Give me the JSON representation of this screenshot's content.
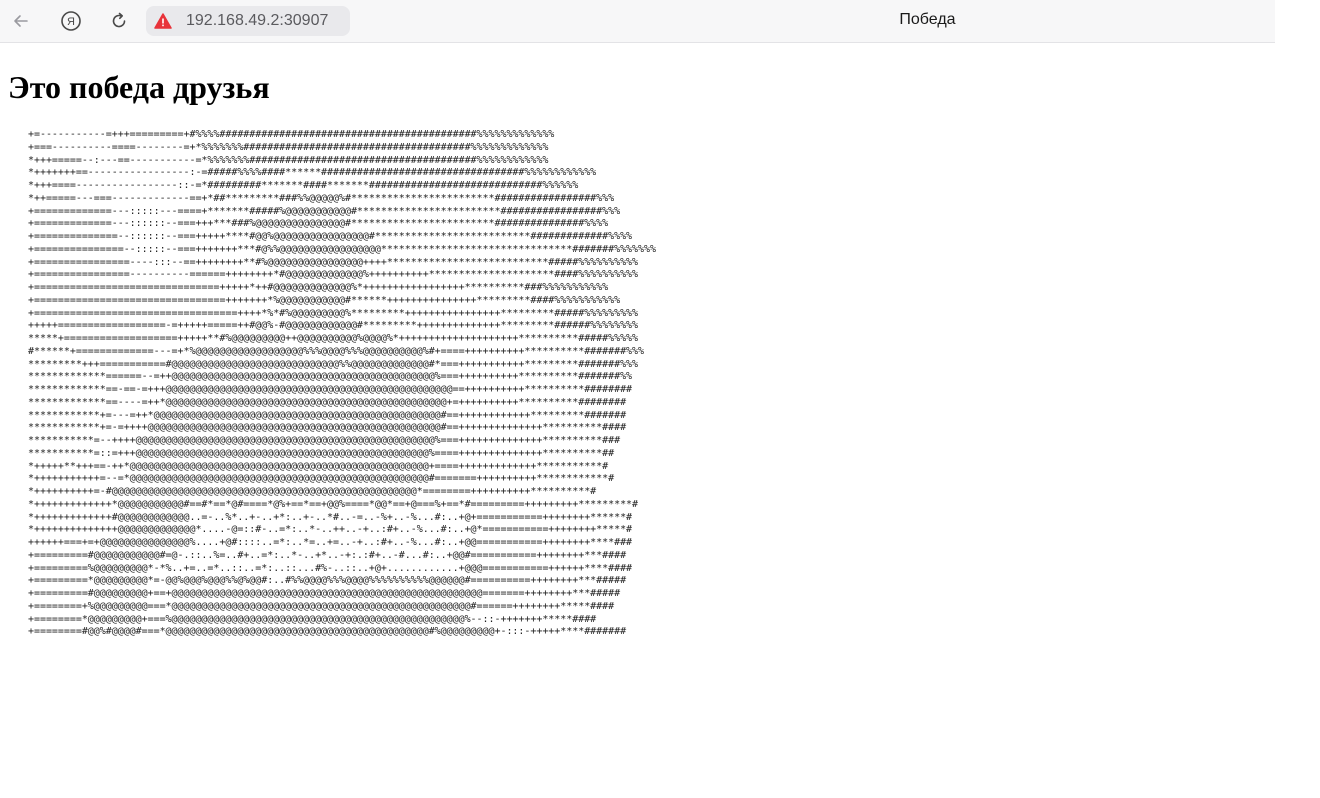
{
  "browser": {
    "url": "192.168.49.2:30907",
    "tab_title": "Победа",
    "icons": {
      "back": "back-arrow-icon",
      "yandex": "yandex-logo-icon",
      "reload": "reload-icon",
      "security": "insecure-warning-icon"
    },
    "colors": {
      "warning": "#e8333a",
      "bar_background": "#f7f7f8",
      "url_pill": "#e9e9ec"
    }
  },
  "page": {
    "title": "Это победа друзья",
    "ascii_art": "+=-----------=+++=========+#%%%%###########################################%%%%%%%%%%%%%\n+===----------====--------=+*%%%%%%%######################################%%%%%%%%%%%%%\n*+++=====--:---==-----------=*%%%%%%%######################################%%%%%%%%%%%%\n*+++++++==-----------------:-=#####%%%%####******##################################%%%%%%%%%%%%\n*+++====-----------------::-=*#########*******####*******#############################%%%%%%\n*++=====---===-------------==+*##*********###%%@@@@@%#************************#################%%%\n+=============---:::::---====+*******#####%@@@@@@@@@@@#************************#################%%%\n+=============---::::::--===+++***###%@@@@@@@@@@@@@@@#************************###############%%%%\n+==============--::::::--===+++++****#@@%@@@@@@@@@@@@@@@@#**************************#############%%%%\n+===============--:::::--===+++++++***#@%%@@@@@@@@@@@@@@@@@********************************#######%%%%%%%\n+================----:::--==++++++++**#%@@@@@@@@@@@@@@@@++++***************************#####%%%%%%%%%%\n+================----------======++++++++*#@@@@@@@@@@@@@%++++++++++*********************####%%%%%%%%%%\n+===============================+++++*++#@@@@@@@@@@@@@%*+++++++++++++++++**********###%%%%%%%%%%%\n+================================+++++++*%@@@@@@@@@@@#******+++++++++++++++*********####%%%%%%%%%%%\n+==================================++++*%*#%@@@@@@@@@%*********++++++++++++++++*********#####%%%%%%%%%\n+++++==================-=+++++=====++#@@%-#@@@@@@@@@@@@#*********++++++++++++++*********######%%%%%%%%\n*****+===================+++++**#%@@@@@@@@@++@@@@@@@@@@%@@@@%*++++++++++++++++++++**********#####%%%%%\n#******+=============---=+*%@@@@@@@@@@@@@@@@@@%%%@@@@%%%@@@@@@@@@@%#+====++++++++++**********#######%%%\n*********+++===========#@@@@@@@@@@@@@@@@@@@@@@@@@@@@%%@@@@@@@@@@@@@#*===+++++++++++*********#######%%%\n*************======--=++@@@@@@@@@@@@@@@@@@@@@@@@@@@@@@@@@@@@@@@@@@@@%===++++++++++**********#######%%\n*************==-==-=+++@@@@@@@@@@@@@@@@@@@@@@@@@@@@@@@@@@@@@@@@@@@@@@@@==++++++++++**********########\n*************==----=++*@@@@@@@@@@@@@@@@@@@@@@@@@@@@@@@@@@@@@@@@@@@@@@@+=++++++++++**********########\n************+=---=++*@@@@@@@@@@@@@@@@@@@@@@@@@@@@@@@@@@@@@@@@@@@@@@@@#==++++++++++++*********#######\n************+=-=++++@@@@@@@@@@@@@@@@@@@@@@@@@@@@@@@@@@@@@@@@@@@@@@@@@#==++++++++++++++**********####\n***********=--++++@@@@@@@@@@@@@@@@@@@@@@@@@@@@@@@@@@@@@@@@@@@@@@@@@@%===++++++++++++++**********###\n***********=::=+++@@@@@@@@@@@@@@@@@@@@@@@@@@@@@@@@@@@@@@@@@@@@@@@@@%====++++++++++++++**********##\n*+++++**+++==-++*@@@@@@@@@@@@@@@@@@@@@@@@@@@@@@@@@@@@@@@@@@@@@@@@@@+====+++++++++++++***********#\n*+++++++++++=--=*@@@@@@@@@@@@@@@@@@@@@@@@@@@@@@@@@@@@@@@@@@@@@@@@@@#=======++++++++++************#\n*++++++++++=-#@@@@@@@@@@@@@@@@@@@@@@@@@@@@@@@@@@@@@@@@@@@@@@@@@@@*========++++++++++**********#\n*+++++++++++++*@@@@@@@@@@@#==#*==*@#====*@%+==*==+@@%====*@@*==+@===%+==*#=========+++++++++*********#\n*+++++++++++++#@@@@@@@@@@@@..=-..%*..+-..+*:..+-..*#..-=..-%+..-%...#:..+@+===========++++++++******#\n*++++++++++++++@@@@@@@@@@@@@*....-@=::#-..=*:..*-..++..-+..:#+..-%...#:..+@*===========++++++++*****#\n++++++===+=+@@@@@@@@@@@@@@@%....+@#::::..=*:..*=..+=..-+..:#+..-%...#:..+@@===========++++++++****###\n+=========#@@@@@@@@@@@#=@-.::..%=..#+..=*:..*-..+*..-+:.:#+..-#...#:..+@@#===========++++++++***####\n+=========%@@@@@@@@@*-*%..+=..=*..::..=*:..::...#%-..::..+@+............+@@@===========++++++****####\n+=========*@@@@@@@@@*=-@@%@@@%@@@%%@%@@#:..#%%@@@@%%%@@@@%%%%%%%%%%@@@@@@#==========++++++++***#####\n+=========#@@@@@@@@@+==+@@@@@@@@@@@@@@@@@@@@@@@@@@@@@@@@@@@@@@@@@@@@@@@@@@@@=======++++++++***#####\n+========+%@@@@@@@@@===*@@@@@@@@@@@@@@@@@@@@@@@@@@@@@@@@@@@@@@@@@@@@@@@@@@#======++++++++*****####\n+========*@@@@@@@@@+===%@@@@@@@@@@@@@@@@@@@@@@@@@@@@@@@@@@@@@@@@@@@@@@@@@%--::-+++++++*****####\n+========#@@%#@@@@#===*@@@@@@@@@@@@@@@@@@@@@@@@@@@@@@@@@@@@@@@@@@@@#%@@@@@@@@@+-:::-+++++****#######"
  }
}
